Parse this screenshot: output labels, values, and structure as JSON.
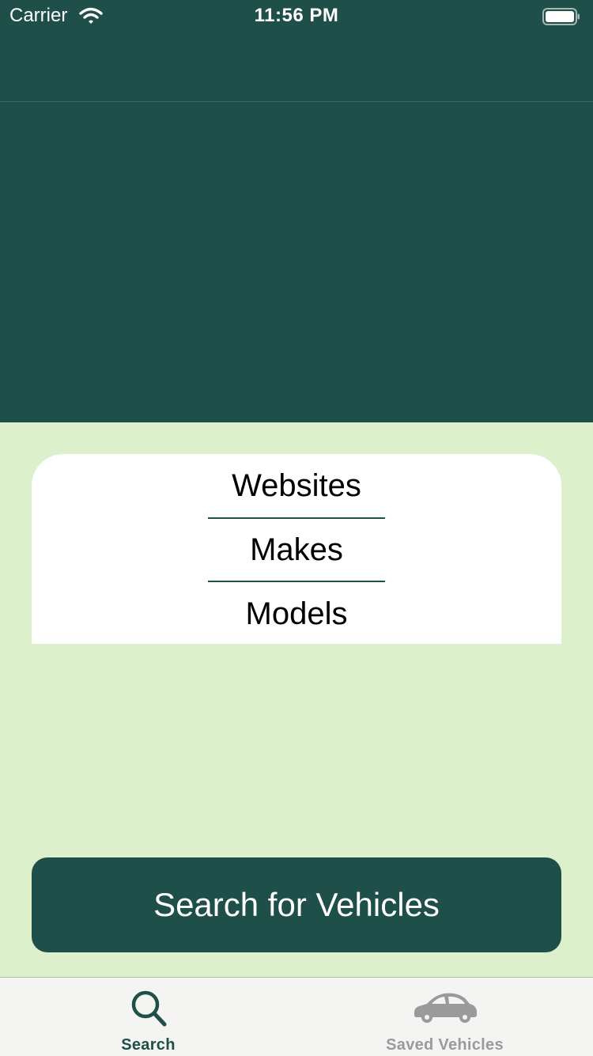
{
  "status_bar": {
    "carrier": "Carrier",
    "time": "11:56 PM",
    "wifi_icon": "wifi-icon",
    "battery_icon": "battery-icon"
  },
  "colors": {
    "primary": "#1e4f48",
    "background": "#dcf0cb",
    "card": "#ffffff",
    "tab_active": "#1e4f48",
    "tab_inactive": "#9a9a9a"
  },
  "filters": {
    "items": [
      {
        "label": "Websites"
      },
      {
        "label": "Makes"
      },
      {
        "label": "Models"
      }
    ]
  },
  "search_button": {
    "label": "Search for Vehicles"
  },
  "tab_bar": {
    "tabs": [
      {
        "label": "Search",
        "icon": "search-icon",
        "active": true
      },
      {
        "label": "Saved Vehicles",
        "icon": "car-icon",
        "active": false
      }
    ]
  }
}
